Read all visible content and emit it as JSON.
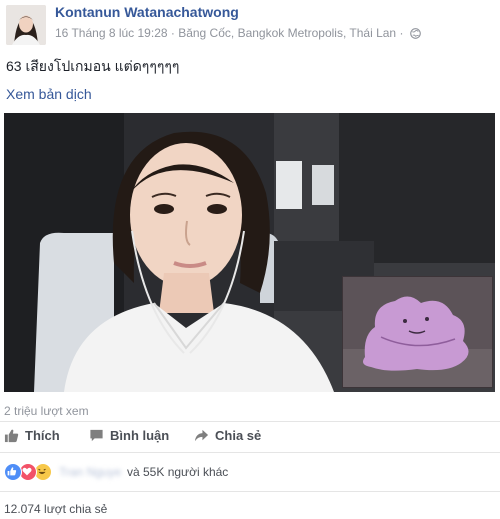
{
  "post": {
    "author": "Kontanun Watanachatwong",
    "meta": "16 Tháng 8 lúc 19:28 · Băng Cốc, Bangkok Metropolis, Thái Lan ·",
    "text": "63 เสียงโปเกมอน แต่ดๆๆๆๆๆ",
    "translate_link": "Xem bản dịch"
  },
  "video": {
    "views": "2 triệu lượt xem"
  },
  "actions": {
    "like": "Thích",
    "comment": "Bình luận",
    "share": "Chia sẻ"
  },
  "reactions": {
    "names_blurred": "Tran Nguyen",
    "others": "và 55K người khác"
  },
  "shares": "12.074 lượt chia sẻ",
  "colors": {
    "link": "#365899",
    "like_blue": "#4f8ef7",
    "love_red": "#f25268",
    "haha_yellow": "#f7c84a"
  }
}
